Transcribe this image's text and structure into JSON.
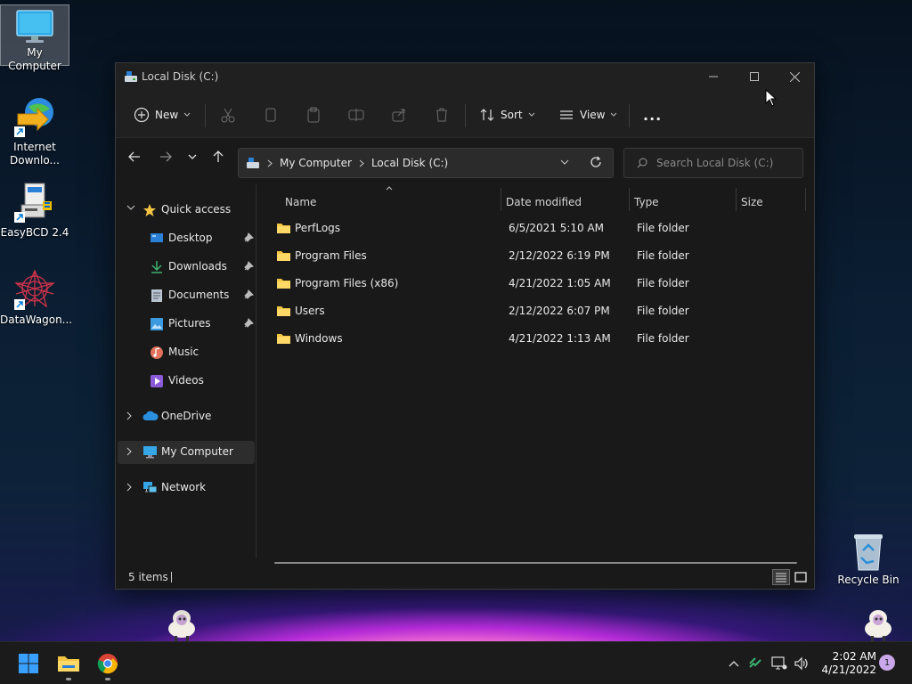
{
  "desktop": {
    "icons": [
      {
        "label": "My Computer"
      },
      {
        "label": "Internet Downlo..."
      },
      {
        "label": "EasyBCD 2.4"
      },
      {
        "label": "DataWagon..."
      },
      {
        "label": "Recycle Bin"
      }
    ]
  },
  "window": {
    "title": "Local Disk (C:)",
    "toolbar": {
      "new_label": "New",
      "sort_label": "Sort",
      "view_label": "View",
      "more_label": "..."
    },
    "address": {
      "crumbs": [
        "My Computer",
        "Local Disk (C:)"
      ]
    },
    "search": {
      "placeholder": "Search Local Disk (C:)"
    },
    "sidebar": {
      "quick_access": "Quick access",
      "items": [
        {
          "label": "Desktop"
        },
        {
          "label": "Downloads"
        },
        {
          "label": "Documents"
        },
        {
          "label": "Pictures"
        },
        {
          "label": "Music"
        },
        {
          "label": "Videos"
        }
      ],
      "onedrive": "OneDrive",
      "my_computer": "My Computer",
      "network": "Network"
    },
    "columns": {
      "name": "Name",
      "date": "Date modified",
      "type": "Type",
      "size": "Size"
    },
    "files": [
      {
        "name": "PerfLogs",
        "date": "6/5/2021 5:10 AM",
        "type": "File folder"
      },
      {
        "name": "Program Files",
        "date": "2/12/2022 6:19 PM",
        "type": "File folder"
      },
      {
        "name": "Program Files (x86)",
        "date": "4/21/2022 1:05 AM",
        "type": "File folder"
      },
      {
        "name": "Users",
        "date": "2/12/2022 6:07 PM",
        "type": "File folder"
      },
      {
        "name": "Windows",
        "date": "4/21/2022 1:13 AM",
        "type": "File folder"
      }
    ],
    "status": {
      "count": "5 items"
    }
  },
  "taskbar": {
    "time": "2:02 AM",
    "date": "4/21/2022",
    "notification_count": "1"
  },
  "colors": {
    "folder": "#f4c542",
    "accent": "#0078d4"
  }
}
